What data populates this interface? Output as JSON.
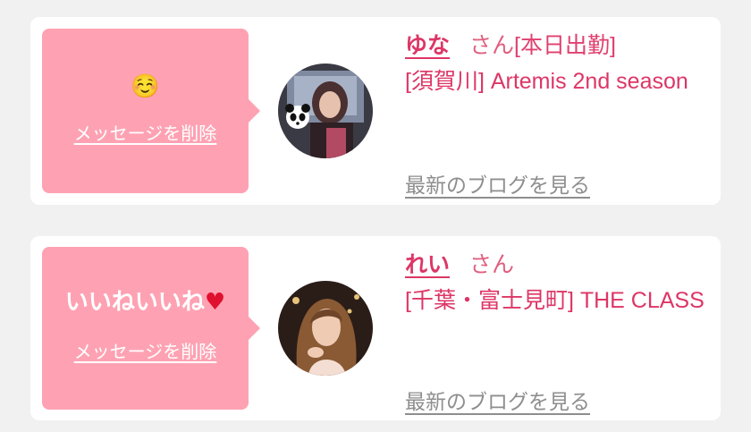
{
  "messages": [
    {
      "message_text": "☺️",
      "delete_label": "メッセージを削除",
      "name": "ゆな",
      "honorific": "さん",
      "status": "[本日出勤]",
      "shop": "[須賀川] Artemis 2nd season",
      "blog_label": "最新のブログを見る",
      "avatar_icon": "photo-avatar"
    },
    {
      "message_text": "いいねいいね",
      "message_emoji": "♥",
      "delete_label": "メッセージを削除",
      "name": "れい",
      "honorific": "さん",
      "shop": "[千葉・富士見町] THE CLASS",
      "blog_label": "最新のブログを見る",
      "avatar_icon": "photo-avatar"
    }
  ],
  "colors": {
    "background": "#f1f1f1",
    "bubble": "#fea2b3",
    "accent": "#dd3666",
    "link_gray": "#8e8e8e"
  }
}
